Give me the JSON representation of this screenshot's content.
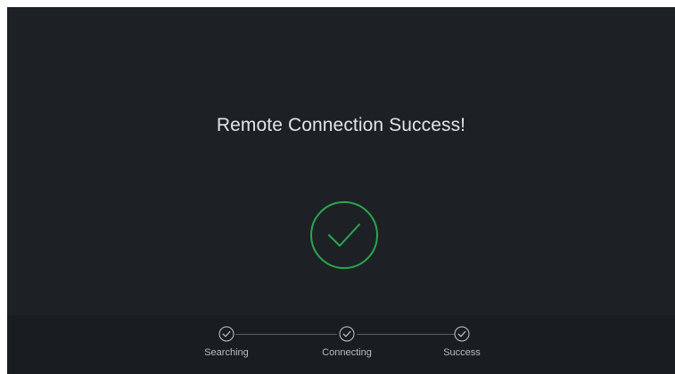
{
  "screen": {
    "title": "Remote Connection Success!"
  },
  "status_icon": "circle-check-icon",
  "colors": {
    "accent": "#27a74a",
    "background": "#1d2126",
    "footer": "#191c20"
  },
  "progress": {
    "steps": [
      {
        "label": "Searching",
        "icon": "check-icon",
        "state": "done"
      },
      {
        "label": "Connecting",
        "icon": "check-icon",
        "state": "done"
      },
      {
        "label": "Success",
        "icon": "check-icon",
        "state": "done"
      }
    ]
  }
}
